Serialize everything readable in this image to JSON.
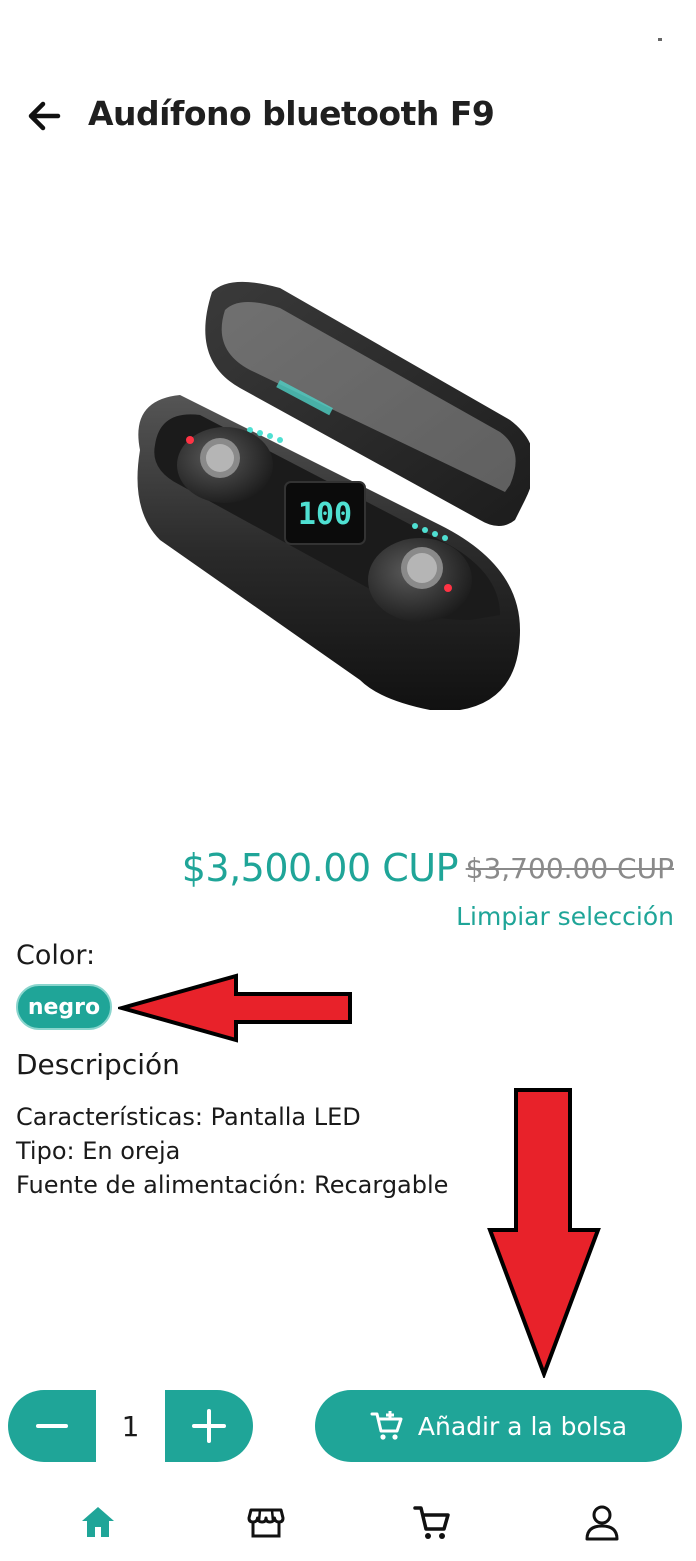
{
  "header": {
    "title": "Audífono bluetooth F9"
  },
  "product": {
    "price": "$3,500.00 CUP",
    "old_price": "$3,700.00 CUP",
    "display_digits": "100"
  },
  "variants": {
    "clear_label": "Limpiar selección",
    "color_label": "Color:",
    "selected_color": "negro"
  },
  "description": {
    "title": "Descripción",
    "lines": [
      "Características: Pantalla LED",
      "Tipo: En oreja",
      "Fuente de alimentación: Recargable"
    ]
  },
  "actions": {
    "quantity": "1",
    "add_to_bag_label": "Añadir a la bolsa"
  },
  "colors": {
    "accent": "#1fa598",
    "annotation_arrow": "#e8222a"
  },
  "bottom_nav": {
    "items": [
      "home-icon",
      "store-icon",
      "cart-icon",
      "profile-icon"
    ],
    "active": "home-icon"
  }
}
